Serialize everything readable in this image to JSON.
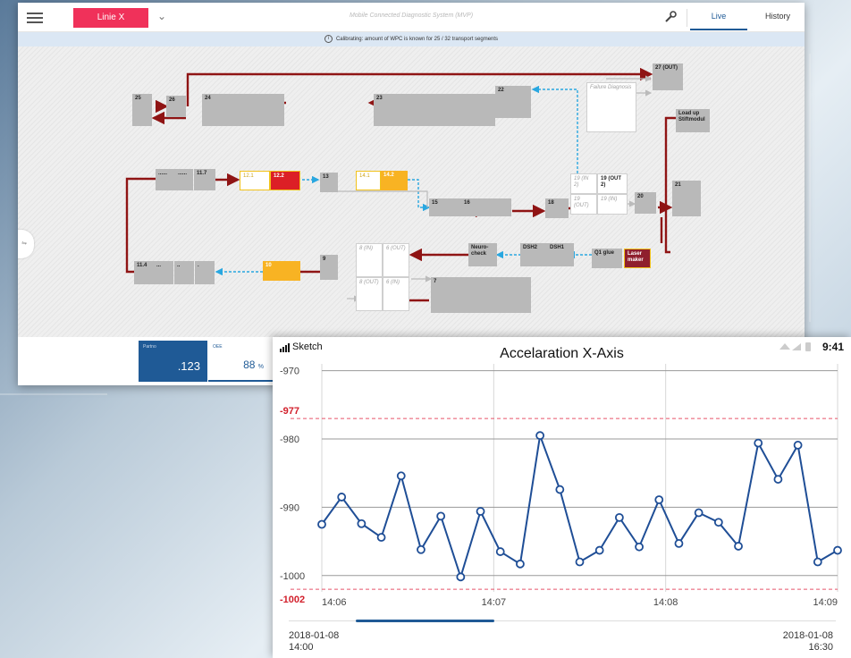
{
  "desktop": {
    "line_select": "Linie X",
    "app_title": "Mobile Connected Diagnostic System (MVP)",
    "tabs": {
      "live": "Live",
      "history": "History"
    },
    "calibration_message": "Calibrating: amount of WPC is known for 25 / 32 transport segments",
    "stations": {
      "s25": "25",
      "s26": "26",
      "s24": "24",
      "s23": "23",
      "s22": "22",
      "failure_diagnosis": "Failure Diagnosis",
      "s27": "27 (OUT)",
      "load_up": "Load up Stiftmodul",
      "dots1": "......",
      "dots2": "......",
      "s11_7": "11.7",
      "s12_1": "12.1",
      "s12_2": "12.2",
      "s13": "13",
      "s14_1": "14.1",
      "s14_2": "14.2",
      "s19_in2": "19 (IN 2)",
      "s19_out2": "19 (OUT 2)",
      "s19_out": "19 (OUT)",
      "s19_in": "19 (IN)",
      "s20": "20",
      "s21": "21",
      "s15": "15",
      "s16": "16",
      "s18": "18",
      "neuro": "Neuro-check",
      "dsh2": "DSH2",
      "dsh1": "DSH1",
      "q1glue": "Q1 glue",
      "laser": "Laser maker",
      "s8_in": "8 (IN)",
      "s6_out": "6 (OUT)",
      "s8_out": "8 (OUT)",
      "s6_in": "6 (IN)",
      "s9": "9",
      "s7": "7",
      "s10": "10",
      "s11_4": "11.4",
      "dots3": "...",
      "dots4": "..",
      "dot5": "."
    },
    "kpi": {
      "partno_label": "Partno",
      "partno_value": ".123",
      "oee_label": "OEE",
      "oee_value": "88",
      "oee_unit": "%"
    }
  },
  "phone": {
    "carrier": "Sketch",
    "time": "9:41",
    "range_start_date": "2018-01-08",
    "range_start_time": "14:00",
    "range_end_date": "2018-01-08",
    "range_end_time": "16:30"
  },
  "chart_data": {
    "type": "line",
    "title": "Accelaration X-Axis",
    "xlabel": "",
    "ylabel": "",
    "xtick_labels": [
      "14:06",
      "14:07",
      "14:08",
      "14:09"
    ],
    "ytick_labels": [
      "-970",
      "-980",
      "-990",
      "-1000"
    ],
    "ylim": [
      -1005,
      -969
    ],
    "thresholds": [
      {
        "label": "-977",
        "value": -977,
        "color": "#e8546a"
      },
      {
        "label": "-1002",
        "value": -1002,
        "color": "#e8546a"
      }
    ],
    "series": [
      {
        "color": "#1f4e96",
        "x": [
          0.0,
          0.25,
          0.5,
          0.75,
          1.0,
          1.25,
          1.5,
          1.75,
          2.0,
          2.25,
          2.5,
          2.75,
          3.0,
          3.25,
          3.5,
          3.75,
          4.0,
          4.25,
          4.5,
          4.75,
          5.0,
          5.25,
          5.5,
          5.75,
          6.0,
          6.25,
          6.5
        ],
        "values": [
          -992.5,
          -988.5,
          -992.4,
          -994.4,
          -985.4,
          -996.2,
          -991.3,
          -1000.2,
          -990.6,
          -996.5,
          -998.3,
          -979.5,
          -987.4,
          -998.0,
          -996.3,
          -991.5,
          -995.8,
          -988.9,
          -995.3,
          -990.8,
          -992.2,
          -995.7,
          -980.6,
          -985.9,
          -980.9,
          -998.0,
          -996.3
        ]
      }
    ]
  }
}
